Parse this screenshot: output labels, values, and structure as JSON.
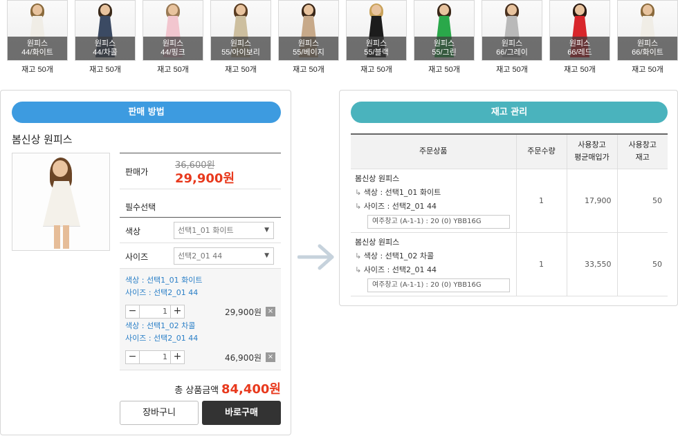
{
  "products": [
    {
      "name": "원피스",
      "variant": "44/화이트",
      "stock": "재고 50개",
      "color": "#f0ede6",
      "hair": "#8a6a3c"
    },
    {
      "name": "원피스",
      "variant": "44/차콜",
      "stock": "재고 50개",
      "color": "#3b4a63",
      "hair": "#3b2a1a"
    },
    {
      "name": "원피스",
      "variant": "44/핑크",
      "stock": "재고 50개",
      "color": "#f2c6cf",
      "hair": "#9a7a55"
    },
    {
      "name": "원피스",
      "variant": "55/아이보리",
      "stock": "재고 50개",
      "color": "#cdbf9f",
      "hair": "#5a3d22"
    },
    {
      "name": "원피스",
      "variant": "55/베이지",
      "stock": "재고 50개",
      "color": "#c7a989",
      "hair": "#3a2718"
    },
    {
      "name": "원피스",
      "variant": "55/블랙",
      "stock": "재고 50개",
      "color": "#1c1c1c",
      "hair": "#c9a25a"
    },
    {
      "name": "원피스",
      "variant": "55/그린",
      "stock": "재고 50개",
      "color": "#2aa84a",
      "hair": "#3a2718"
    },
    {
      "name": "원피스",
      "variant": "66/그레이",
      "stock": "재고 50개",
      "color": "#b9b9b9",
      "hair": "#4a3220"
    },
    {
      "name": "원피스",
      "variant": "66/레드",
      "stock": "재고 50개",
      "color": "#d8262b",
      "hair": "#2a1a12"
    },
    {
      "name": "원피스",
      "variant": "66/화이트",
      "stock": "재고 50개",
      "color": "#f0ede6",
      "hair": "#8a6a3c"
    }
  ],
  "sales": {
    "title": "판매 방법",
    "product_name": "봄신상 원피스",
    "price_label": "판매가",
    "original_price": "36,600원",
    "sale_price": "29,900원",
    "required_label": "필수선택",
    "color_label": "색상",
    "color_value": "선택1_01 화이트",
    "size_label": "사이즈",
    "size_value": "선택2_01 44",
    "selected": [
      {
        "color_line": "색상 : 선택1_01 화이트",
        "size_line": "사이즈 : 선택2_01 44",
        "qty": "1",
        "price": "29,900원"
      },
      {
        "color_line": "색상 : 선택1_02 차콜",
        "size_line": "사이즈 : 선택2_01 44",
        "qty": "1",
        "price": "46,900원"
      }
    ],
    "total_label": "총 상품금액",
    "total_price": "84,400원",
    "cart_label": "장바구니",
    "buy_label": "바로구매"
  },
  "inventory": {
    "title": "재고 관리",
    "headers": {
      "product": "주문상품",
      "qty": "주문수량",
      "avg_price_1": "사용창고",
      "avg_price_2": "평균매입가",
      "stock_1": "사용창고",
      "stock_2": "재고"
    },
    "rows": [
      {
        "name": "봄신상 원피스",
        "opt1": "색상 : 선택1_01 화이트",
        "opt2": "사이즈 : 선택2_01 44",
        "warehouse": "여주창고 (A-1-1) : 20 (0) YBB16G",
        "qty": "1",
        "avg_price": "17,900",
        "stock": "50"
      },
      {
        "name": "봄신상 원피스",
        "opt1": "색상 : 선택1_02 차콜",
        "opt2": "사이즈 : 선택2_01 44",
        "warehouse": "여주창고 (A-1-1) : 20 (0) YBB16G",
        "qty": "1",
        "avg_price": "33,550",
        "stock": "50"
      }
    ]
  },
  "icons": {
    "minus": "−",
    "plus": "+",
    "remove": "×",
    "dropdown": "▼",
    "tree_arrow": "↳"
  },
  "colors": {
    "accent_blue": "#3d9be0",
    "accent_teal": "#4ab3bd",
    "price_red": "#e8391d",
    "option_blue": "#2a7fc7"
  }
}
